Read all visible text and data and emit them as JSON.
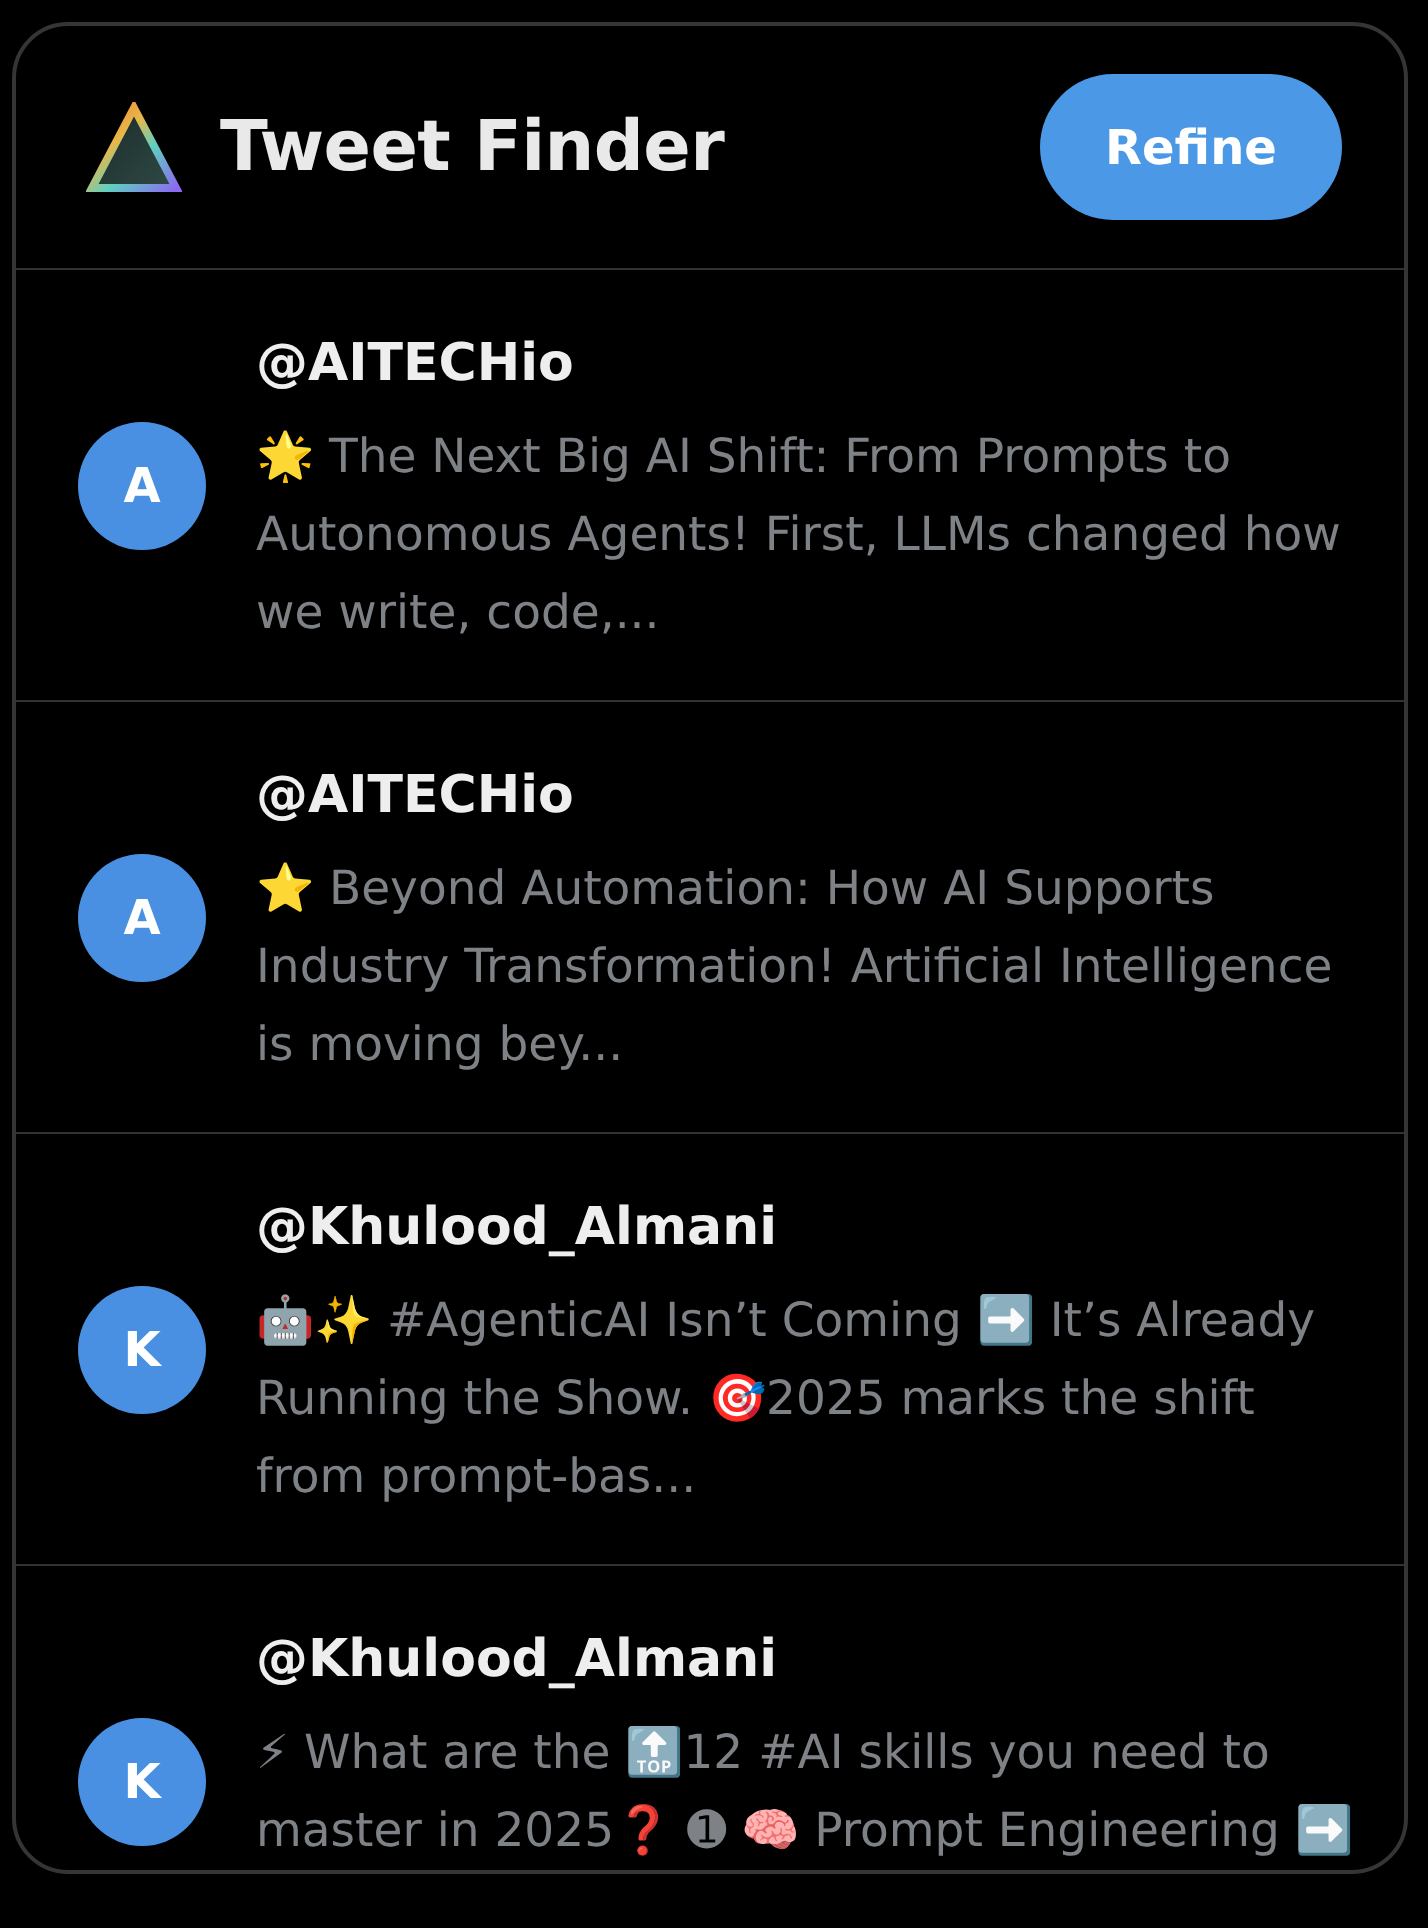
{
  "app": {
    "title": "Tweet Finder",
    "refine_button": "Refine"
  },
  "tweets": [
    {
      "avatar_initial": "A",
      "handle": "@AITECHio",
      "text": "🌟 The Next Big AI Shift: From Prompts to Autonomous Agents! First, LLMs changed how we write, code,..."
    },
    {
      "avatar_initial": "A",
      "handle": "@AITECHio",
      "text": "⭐ Beyond Automation: How AI Supports Industry Transformation! Artificial Intelligence is moving bey..."
    },
    {
      "avatar_initial": "K",
      "handle": "@Khulood_Almani",
      "text": "🤖✨ #AgenticAI Isn’t Coming ➡️ It’s Already Running the Show. 🎯2025 marks the shift from prompt-bas..."
    },
    {
      "avatar_initial": "K",
      "handle": "@Khulood_Almani",
      "text": "⚡ What are the 🔝12 #AI skills you need to master in 2025❓ ➊ 🧠 Prompt Engineering ➡️"
    }
  ]
}
